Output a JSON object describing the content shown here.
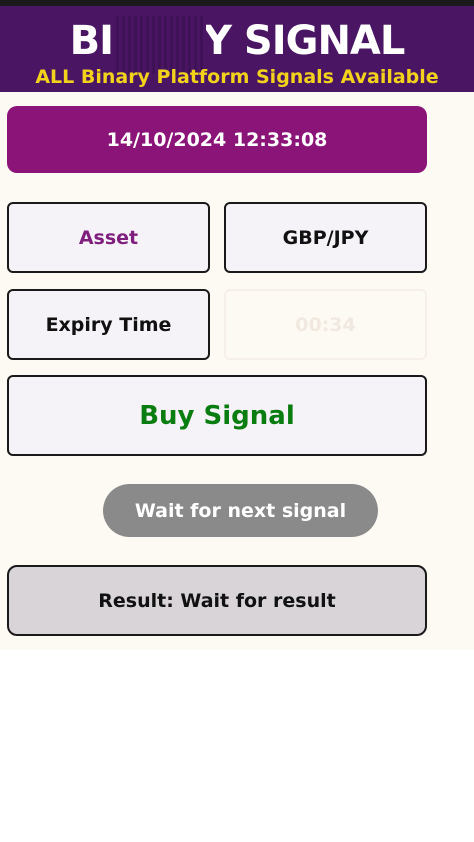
{
  "header": {
    "brand": "BINARY SIGNAL",
    "tagline": "ALL Binary Platform Signals Available"
  },
  "datetime": "14/10/2024 12:33:08",
  "asset": {
    "label": "Asset",
    "value": "GBP/JPY"
  },
  "expiry": {
    "label": "Expiry Time",
    "timer": "00:34"
  },
  "signal": "Buy Signal",
  "wait_button": "Wait for next signal",
  "result": "Result: Wait for result",
  "colors": {
    "header_bg": "#4a1663",
    "tagline": "#f3d21b",
    "datetime_bg": "#8b1479",
    "asset_label": "#7e1f7d",
    "signal_text": "#0a7d10",
    "wait_button_bg": "#8a8a8a",
    "result_bg": "#d8d4d8"
  }
}
